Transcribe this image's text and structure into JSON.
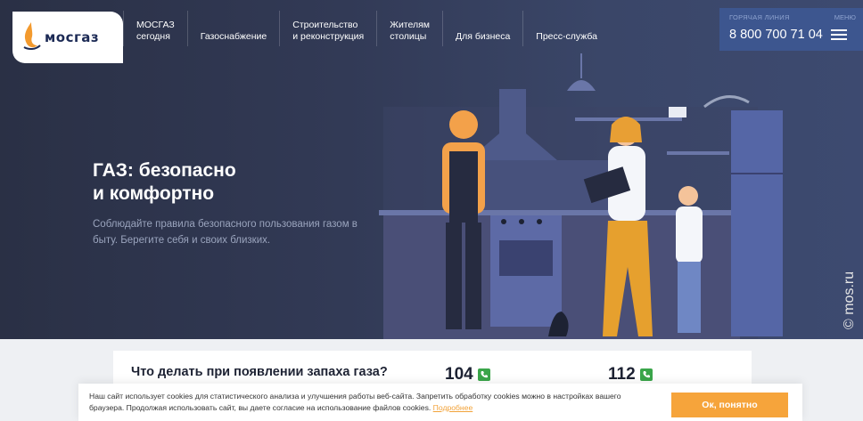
{
  "header": {
    "logo_text": "мосгаз",
    "nav": [
      {
        "label": "МОСГАЗ\nсегодня"
      },
      {
        "label": "Газоснабжение"
      },
      {
        "label": "Строительство\nи реконструкция"
      },
      {
        "label": "Жителям\nстолицы"
      },
      {
        "label": "Для бизнеса"
      },
      {
        "label": "Пресс-служба"
      }
    ],
    "hotline_caption": "ГОРЯЧАЯ ЛИНИЯ",
    "hotline_number": "8 800 700 71 04",
    "menu_caption": "МЕНЮ"
  },
  "hero": {
    "title": "ГАЗ: безопасно\nи комфортно",
    "subtitle": "Соблюдайте правила безопасного пользования газом в быту. Берегите себя и своих близких.",
    "watermark": "© mos.ru"
  },
  "gas_info": {
    "question": "Что делать при появлении запаха газа?",
    "phone_1": "104",
    "phone_2": "112"
  },
  "cookie": {
    "text": "Наш сайт использует cookies для статистического анализа и улучшения работы веб-сайта. Запретить обработку cookies можно в настройках вашего браузера. Продолжая использовать сайт, вы даете согласие на использование файлов cookies. ",
    "link": "Подробнее",
    "button": "Ок, понятно"
  },
  "colors": {
    "accent": "#f6a43b",
    "hotline_bg": "#3d568f",
    "phone_icon": "#3aa54a"
  }
}
